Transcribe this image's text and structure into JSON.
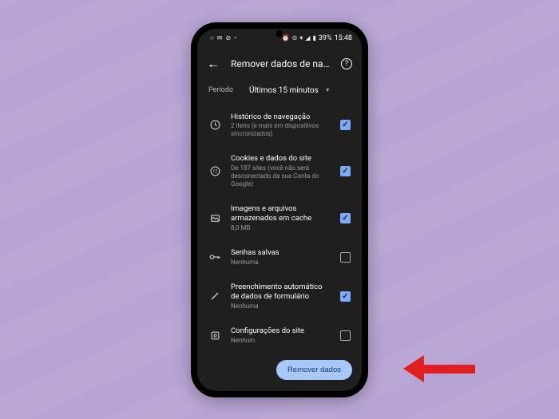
{
  "status": {
    "battery": "39%",
    "time": "15:48"
  },
  "header": {
    "title": "Remover dados de na..."
  },
  "period": {
    "label": "Período",
    "value": "Últimos 15 minutos"
  },
  "items": [
    {
      "icon": "clock",
      "title": "Histórico de navegação",
      "subtitle": "2 itens (e mais em dispositivos sincronizados)",
      "checked": true
    },
    {
      "icon": "cookie",
      "title": "Cookies e dados do site",
      "subtitle": "De 187 sites (você não será desconectado da sua Conta do Google)",
      "checked": true
    },
    {
      "icon": "image",
      "title": "Imagens e arquivos armazenados em cache",
      "subtitle": "8,0 MB",
      "checked": true
    },
    {
      "icon": "key",
      "title": "Senhas salvas",
      "subtitle": "Nenhuma",
      "checked": false
    },
    {
      "icon": "pencil",
      "title": "Preenchimento automático de dados de formulário",
      "subtitle": "Nenhuma",
      "checked": true
    },
    {
      "icon": "settings-box",
      "title": "Configurações do site",
      "subtitle": "Nenhum",
      "checked": false
    }
  ],
  "action": {
    "label": "Remover dados"
  }
}
